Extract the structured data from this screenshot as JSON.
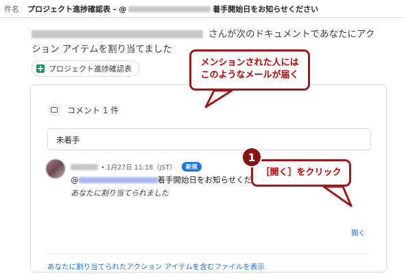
{
  "subject": {
    "label": "件名",
    "title_prefix": "プロジェクト進捗確認表 - @",
    "title_suffix": "着手開始日をお知らせください"
  },
  "intro": {
    "text_line1": "さんが次のドキュメントであなたにアク",
    "text_line2": "ション アイテムを割り当てました"
  },
  "doc_chip": {
    "label": "プロジェクト進捗確認表",
    "icon": "spreadsheet-icon"
  },
  "comment": {
    "header": "コメント 1 件",
    "quoted_text": "未着手",
    "timestamp": "• 1月27日 11:18（JST）",
    "badge": "新規",
    "mention_prefix": "@",
    "message": "着手開始日をお知らせください",
    "assigned_note": "あなたに割り当てられました",
    "open_label": "開く"
  },
  "footer_link": "あなたに割り当てられたアクション アイテムを含むファイルを表示",
  "annotations": {
    "callout1_line1": "メンションされた人には",
    "callout1_line2": "このようなメールが届く",
    "step_number": "1",
    "callout2": "［開く］をクリック",
    "accent_color": "#a31515"
  }
}
